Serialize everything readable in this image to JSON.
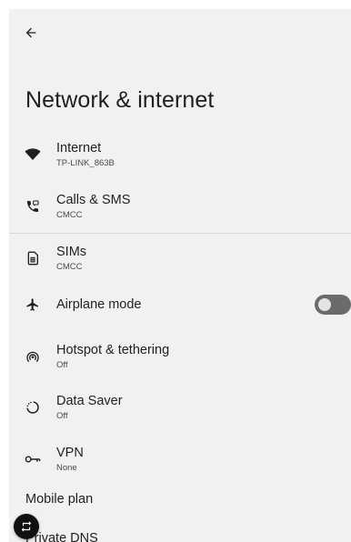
{
  "header": {
    "back_icon": "arrow-back-icon",
    "title": "Network & internet"
  },
  "items": [
    {
      "key": "internet",
      "title": "Internet",
      "subtitle": "TP-LINK_863B",
      "icon": "wifi-icon"
    },
    {
      "key": "calls",
      "title": "Calls & SMS",
      "subtitle": "CMCC",
      "icon": "phone-sms-icon"
    },
    {
      "key": "sims",
      "title": "SIMs",
      "subtitle": "CMCC",
      "icon": "sim-card-icon"
    },
    {
      "key": "airplane",
      "title": "Airplane mode",
      "icon": "airplane-icon",
      "toggle": false
    },
    {
      "key": "hotspot",
      "title": "Hotspot & tethering",
      "subtitle": "Off",
      "icon": "hotspot-icon"
    },
    {
      "key": "datasaver",
      "title": "Data Saver",
      "subtitle": "Off",
      "icon": "data-saver-icon"
    },
    {
      "key": "vpn",
      "title": "VPN",
      "subtitle": "None",
      "icon": "vpn-key-icon"
    }
  ],
  "extra": {
    "mobile_plan": "Mobile plan",
    "private_dns": "Private DNS"
  },
  "floating_button": {
    "icon": "rotate-icon"
  },
  "colors": {
    "background": "#f1f1f1",
    "text_primary": "#1f1f1f",
    "toggle_track_off": "#6b6b6b",
    "fab": "#101010"
  }
}
